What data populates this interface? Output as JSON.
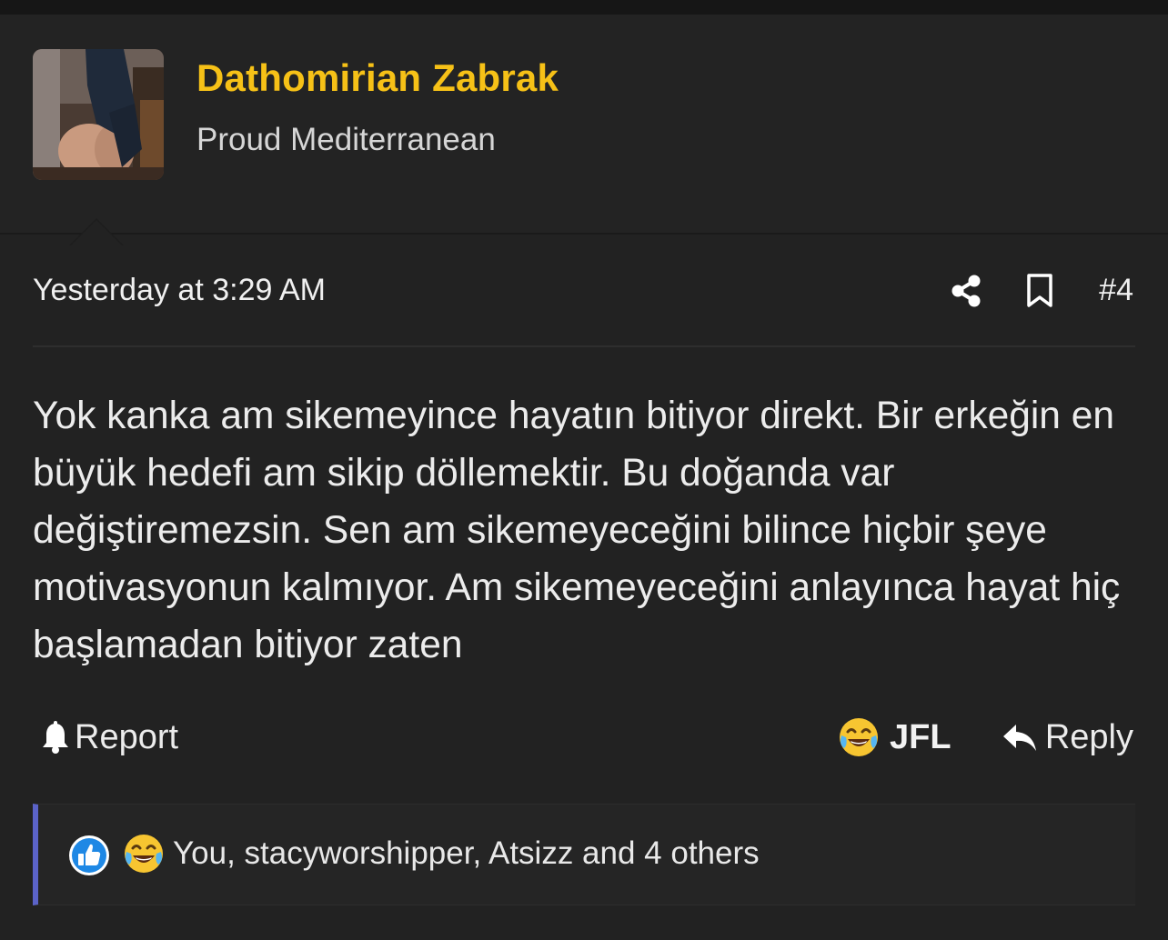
{
  "user": {
    "name": "Dathomirian Zabrak",
    "title": "Proud Mediterranean"
  },
  "post": {
    "timestamp": "Yesterday at 3:29 AM",
    "number": "#4",
    "body": "Yok kanka am sikemeyince hayatın bitiyor direkt. Bir erkeğin en büyük hedefi am sikip döllemektir. Bu doğanda var değiştiremezsin. Sen am sikemeyeceğini bilince hiçbir şeye motivasyonun kalmıyor. Am sikemeyeceğini anlayınca hayat hiç başlamadan bitiyor zaten"
  },
  "actions": {
    "report_label": "Report",
    "jfl_label": "JFL",
    "reply_label": "Reply"
  },
  "reactions": {
    "summary": "You, stacyworshipper, Atsizz and 4 others"
  },
  "colors": {
    "username": "#f6c117",
    "background": "#222222",
    "reaction_bar_accent": "#5b63c8",
    "like_icon": "#1e88e5"
  },
  "icons": {
    "share": "share-icon",
    "bookmark": "bookmark-icon",
    "report": "bell-icon",
    "jfl": "laughing-crying-emoji-icon",
    "reply": "reply-arrow-icon",
    "like": "thumbs-up-icon"
  }
}
